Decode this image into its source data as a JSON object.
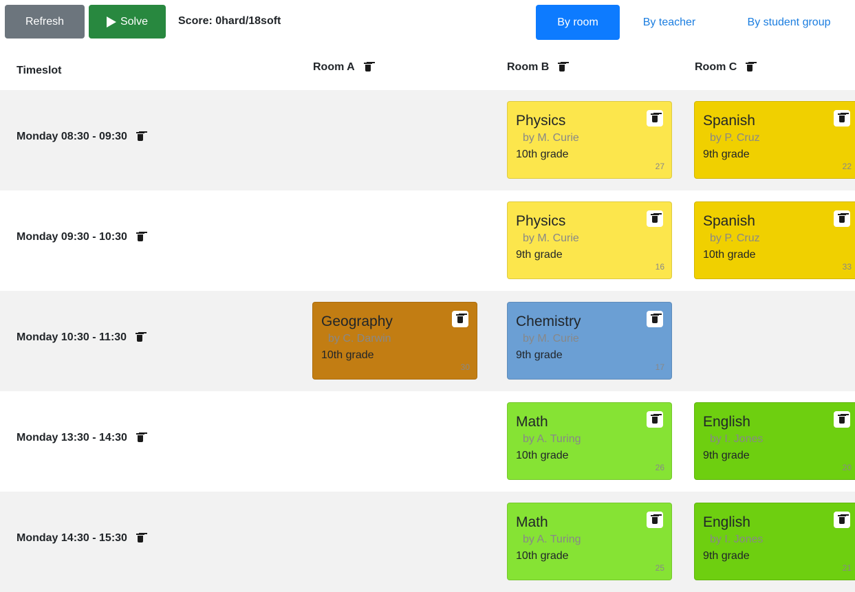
{
  "toolbar": {
    "refresh_label": "Refresh",
    "solve_label": "Solve",
    "score_text": "Score: 0hard/18soft",
    "views": [
      "By room",
      "By teacher",
      "By student group"
    ],
    "active_view": "By room"
  },
  "header": {
    "timeslot_label": "Timeslot",
    "rooms": [
      "Room A",
      "Room B",
      "Room C"
    ]
  },
  "timeslots": [
    "Monday 08:30 - 09:30",
    "Monday 09:30 - 10:30",
    "Monday 10:30 - 11:30",
    "Monday 13:30 - 14:30",
    "Monday 14:30 - 15:30"
  ],
  "lessons": [
    {
      "slot": 0,
      "room": 1,
      "subject": "Physics",
      "teacher": "by M. Curie",
      "group": "10th grade",
      "id": "27",
      "color": "#fce64c"
    },
    {
      "slot": 0,
      "room": 2,
      "subject": "Spanish",
      "teacher": "by P. Cruz",
      "group": "9th grade",
      "id": "22",
      "color": "#f0d000"
    },
    {
      "slot": 1,
      "room": 1,
      "subject": "Physics",
      "teacher": "by M. Curie",
      "group": "9th grade",
      "id": "16",
      "color": "#fce64c"
    },
    {
      "slot": 1,
      "room": 2,
      "subject": "Spanish",
      "teacher": "by P. Cruz",
      "group": "10th grade",
      "id": "33",
      "color": "#f0d000"
    },
    {
      "slot": 2,
      "room": 0,
      "subject": "Geography",
      "teacher": "by C. Darwin",
      "group": "10th grade",
      "id": "30",
      "color": "#c27d13"
    },
    {
      "slot": 2,
      "room": 1,
      "subject": "Chemistry",
      "teacher": "by M. Curie",
      "group": "9th grade",
      "id": "17",
      "color": "#6b9fd4"
    },
    {
      "slot": 3,
      "room": 1,
      "subject": "Math",
      "teacher": "by A. Turing",
      "group": "10th grade",
      "id": "26",
      "color": "#86e334"
    },
    {
      "slot": 3,
      "room": 2,
      "subject": "English",
      "teacher": "by I. Jones",
      "group": "9th grade",
      "id": "20",
      "color": "#6ecf10"
    },
    {
      "slot": 4,
      "room": 1,
      "subject": "Math",
      "teacher": "by A. Turing",
      "group": "10th grade",
      "id": "25",
      "color": "#86e334"
    },
    {
      "slot": 4,
      "room": 2,
      "subject": "English",
      "teacher": "by I. Jones",
      "group": "9th grade",
      "id": "21",
      "color": "#6ecf10"
    }
  ]
}
